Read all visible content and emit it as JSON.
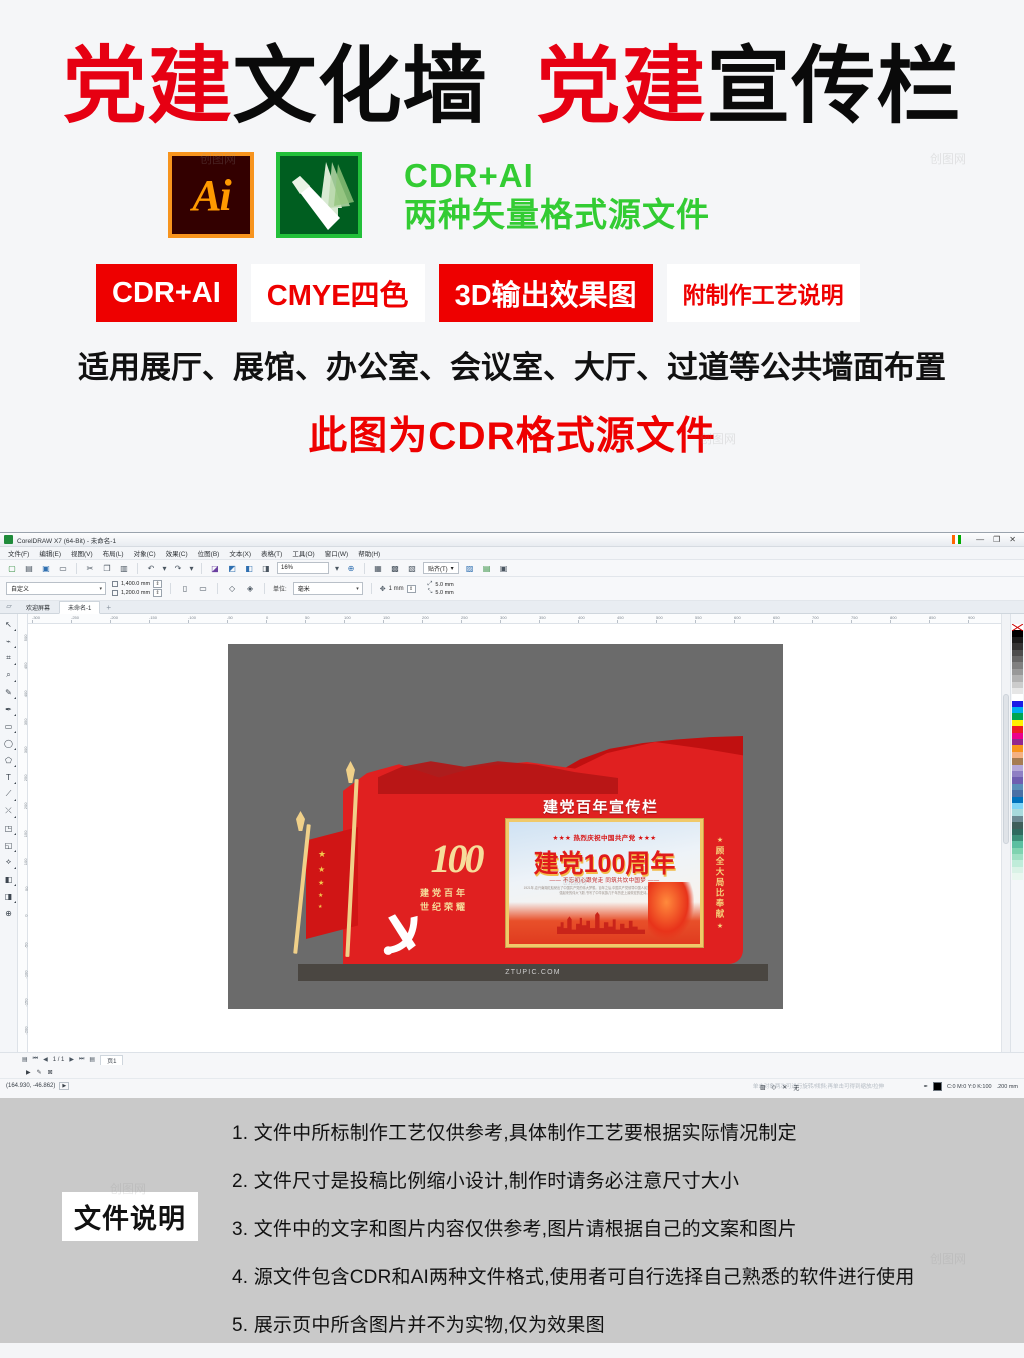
{
  "promo": {
    "title_parts": [
      {
        "text": "党建",
        "color": "red"
      },
      {
        "text": "文化墙",
        "color": "black"
      },
      {
        "text": " ",
        "color": "black"
      },
      {
        "text": "党建",
        "color": "red"
      },
      {
        "text": "宣传栏",
        "color": "black"
      }
    ],
    "title_red_1": "党建",
    "title_black_1": "文化墙",
    "title_red_2": "党建",
    "title_black_2": "宣传栏",
    "ai_icon_label": "Ai",
    "cdr_icon_label": "CorelDRAW",
    "format_line1": "CDR+AI",
    "format_line2": "两种矢量格式源文件",
    "badges": [
      {
        "label": "CDR+AI",
        "style": "red"
      },
      {
        "label": "CMYE四色",
        "style": "white"
      },
      {
        "label": "3D输出效果图",
        "style": "red"
      },
      {
        "label": "附制作工艺说明",
        "style": "white"
      }
    ],
    "usage_line": "适用展厅、展馆、办公室、会议室、大厅、过道等公共墙面布置",
    "source_line": "此图为CDR格式源文件",
    "colors": {
      "red": "#e60012",
      "green": "#33cc33",
      "badge_red": "#ee0000"
    }
  },
  "app": {
    "title": "CorelDRAW X7 (64-Bit) - 未命名-1",
    "window_controls": [
      "—",
      "❐",
      "✕"
    ],
    "menus": [
      "文件(F)",
      "编辑(E)",
      "视图(V)",
      "布局(L)",
      "对象(C)",
      "效果(C)",
      "位图(B)",
      "文本(X)",
      "表格(T)",
      "工具(O)",
      "窗口(W)",
      "帮助(H)"
    ],
    "toolbar": {
      "zoom_level": "16%",
      "snap_label": "贴齐(T)",
      "icons": [
        "new-document",
        "open-document",
        "save-document",
        "print",
        "cut",
        "copy",
        "paste",
        "undo",
        "redo",
        "import",
        "export",
        "publish-pdf",
        "application-launcher",
        "options",
        "full-screen-preview"
      ]
    },
    "property_bar": {
      "page_preset": "自定义",
      "page_width": "1,400.0 mm",
      "page_height": "1,200.0 mm",
      "units_label": "单位:",
      "units_value": "毫米",
      "nudge": "1 mm",
      "duplicate_x": "5.0 mm",
      "duplicate_y": "5.0 mm"
    },
    "tabs": [
      {
        "label": "欢迎屏幕",
        "active": false
      },
      {
        "label": "未命名-1",
        "active": true
      }
    ],
    "tab_add": "+",
    "status": {
      "page_nav": "1 / 1",
      "page_tab": "页1",
      "coordinates": "(164.930, -46.862)",
      "fill_none": "无",
      "outline_color": "C:0 M:0 Y:0 K:100",
      "outline_width": ".200 mm",
      "hint": "单击对象两次可进行旋转/倾斜;再单击可得到缩放/拉伸"
    },
    "rulers": {
      "h_ticks": [
        "-300",
        "-250",
        "-200",
        "-150",
        "-100",
        "-50",
        "0",
        "50",
        "100",
        "150",
        "200",
        "250",
        "300",
        "350",
        "400",
        "450",
        "500",
        "550",
        "600",
        "650",
        "700",
        "750",
        "800",
        "850",
        "900"
      ],
      "v_ticks": [
        "500",
        "450",
        "400",
        "350",
        "300",
        "250",
        "200",
        "150",
        "100",
        "50",
        "0",
        "-50",
        "-100",
        "-150",
        "-200",
        "-250"
      ]
    },
    "tools": [
      "pick-tool",
      "shape-tool",
      "crop-tool",
      "zoom-tool",
      "freehand-tool",
      "artistic-media-tool",
      "rectangle-tool",
      "ellipse-tool",
      "polygon-tool",
      "text-tool",
      "parallel-dimension-tool",
      "straight-line-connector-tool",
      "drop-shadow-tool",
      "transparency-tool",
      "color-eyedropper-tool",
      "interactive-fill-tool",
      "smart-fill-tool",
      "add-page"
    ],
    "palette_colors": [
      "#000000",
      "#1a1a1a",
      "#333333",
      "#4d4d4d",
      "#666666",
      "#808080",
      "#999999",
      "#b3b3b3",
      "#cccccc",
      "#e6e6e6",
      "#ffffff",
      "#1a1ae6",
      "#00aeef",
      "#00a651",
      "#fff200",
      "#ed1c24",
      "#ec008c",
      "#92278f",
      "#f7941e",
      "#f4b183",
      "#a67c52",
      "#b5a8d8",
      "#8f7fc4",
      "#6f5eb0",
      "#5a8fb8",
      "#4a6fa5",
      "#0072bc",
      "#7fd4f5",
      "#a8dadc",
      "#6c8a93",
      "#3f5f5a",
      "#2f6b5f",
      "#3c8f78",
      "#5bbfa0",
      "#7fd3b0",
      "#9fe0c4",
      "#bfecd9",
      "#d9f2e6",
      "#e9f7ef"
    ]
  },
  "artwork": {
    "headline": "建党百年宣传栏",
    "logo_number": "100",
    "logo_sub_line1": "建党百年",
    "logo_sub_line2": "世纪荣耀",
    "side_text": "顾全大局比奉献",
    "base_watermark": "ZTUPIC.COM",
    "poster": {
      "top_line": "热烈庆祝中国共产党",
      "main_line": "建党100周年",
      "sub_line": "—— 不忘初心跟党走 同筑共饮中国梦 ——",
      "body_text": "1921年,嘉兴南湖红船驶出了中国共产党的伟大梦想。百年之后,中国共产党领导中国人民实现了从站起来、富起来到强起来的伟大飞跃,书写了中华民族几千年历史上最恢宏的史诗。",
      "watermark": "创图网"
    },
    "stars_top": [
      "★",
      "★",
      "★",
      "★",
      "★"
    ],
    "flag_stars": [
      "★",
      "★",
      "★",
      "★",
      "★"
    ],
    "colors": {
      "red": "#e02020",
      "gold": "#f2c94c",
      "base": "#4a4641",
      "bg": "#6b6b6b"
    }
  },
  "notes": {
    "label": "文件说明",
    "items": [
      "1. 文件中所标制作工艺仅供参考,具体制作工艺要根据实际情况制定",
      "2. 文件尺寸是投稿比例缩小设计,制作时请务必注意尺寸大小",
      "3. 文件中的文字和图片内容仅供参考,图片请根据自己的文案和图片",
      "4. 源文件包含CDR和AI两种文件格式,使用者可自行选择自己熟悉的软件进行使用",
      "5. 展示页中所含图片并不为实物,仅为效果图"
    ]
  },
  "watermarks": [
    "创图网",
    "创图网",
    "创图网",
    "创图网"
  ]
}
